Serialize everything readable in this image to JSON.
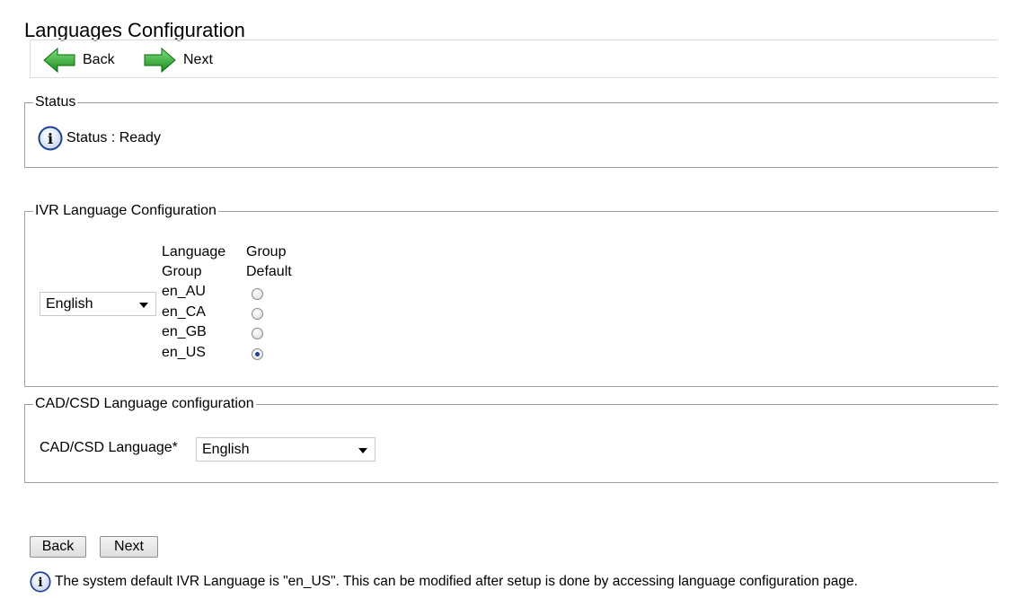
{
  "page": {
    "title": "Languages Configuration"
  },
  "toolbar": {
    "back_label": "Back",
    "next_label": "Next"
  },
  "status": {
    "legend": "Status",
    "text": "Status : Ready"
  },
  "ivr": {
    "legend": "IVR Language Configuration",
    "selected_language": "English",
    "col_language_group": "Language Group",
    "col_group_default": "Group Default",
    "groups": [
      {
        "code": "en_AU",
        "default": false
      },
      {
        "code": "en_CA",
        "default": false
      },
      {
        "code": "en_GB",
        "default": false
      },
      {
        "code": "en_US",
        "default": true
      }
    ]
  },
  "cad": {
    "legend": "CAD/CSD Language configuration",
    "label": "CAD/CSD Language*",
    "selected": "English"
  },
  "buttons": {
    "back": "Back",
    "next": "Next"
  },
  "footer": {
    "note": "The system default IVR Language is \"en_US\". This can be modified after setup is done by accessing language configuration page."
  },
  "colors": {
    "arrow_green": "#2aa82a",
    "info_border": "#1f3f8f"
  },
  "icons": {
    "back": "green-left-arrow-icon",
    "next": "green-right-arrow-icon",
    "info": "info-icon"
  }
}
